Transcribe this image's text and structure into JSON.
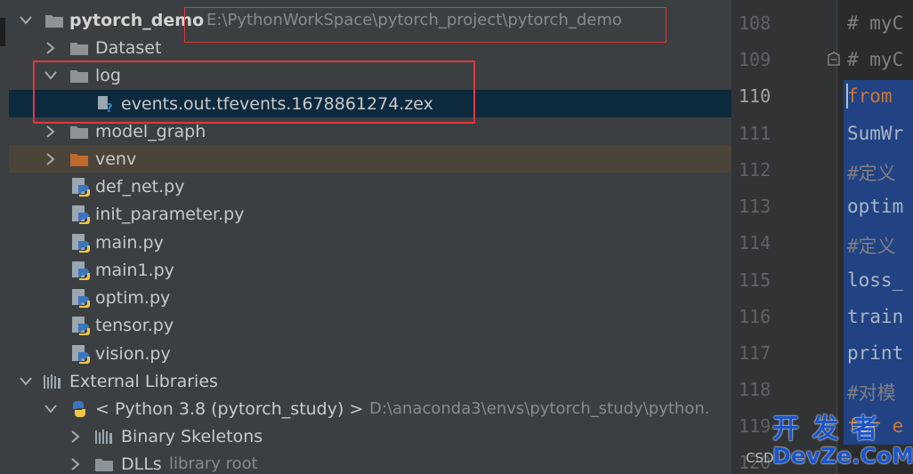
{
  "tree": {
    "project": {
      "name": "pytorch_demo",
      "path": "E:\\PythonWorkSpace\\pytorch_project\\pytorch_demo"
    },
    "dataset": "Dataset",
    "log": "log",
    "events_file": "events.out.tfevents.1678861274.zex",
    "model_graph": "model_graph",
    "venv": "venv",
    "files": [
      "def_net.py",
      "init_parameter.py",
      "main.py",
      "main1.py",
      "optim.py",
      "tensor.py",
      "vision.py"
    ],
    "external_libraries": "External Libraries",
    "python_sdk": {
      "name": "< Python 3.8 (pytorch_study) >",
      "path": "D:\\anaconda3\\envs\\pytorch_study\\python."
    },
    "binary_skeletons": "Binary Skeletons",
    "dlls": {
      "name": "DLLs",
      "hint": "library root"
    }
  },
  "editor": {
    "line_numbers": [
      "108",
      "109",
      "110",
      "111",
      "112",
      "113",
      "114",
      "115",
      "116",
      "117",
      "118",
      "119",
      "120"
    ],
    "lines": [
      "# myC",
      "# myC",
      "from",
      "SumWr",
      "#定义",
      "optim",
      "#定义",
      "loss_",
      "train",
      "print",
      "#对模",
      "for e",
      ""
    ]
  },
  "watermark": {
    "csdn": "CSD",
    "cn": "开 发 者",
    "en": "DevZe.CoM"
  },
  "colors": {
    "selection": "#0d293e",
    "highlight_box": "#e0393c",
    "code_selection": "#214283",
    "keyword": "#cc7832"
  }
}
